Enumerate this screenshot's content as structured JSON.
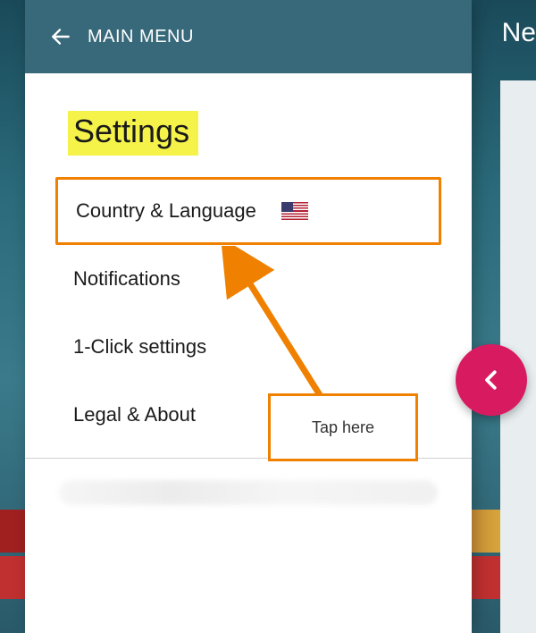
{
  "header": {
    "title": "MAIN MENU",
    "back_icon": "arrow-left"
  },
  "partial_text_right": "Ne",
  "section": {
    "title": "Settings"
  },
  "menu": {
    "items": [
      {
        "label": "Country & Language",
        "highlighted": true,
        "showsFlag": true,
        "flag": "us"
      },
      {
        "label": "Notifications"
      },
      {
        "label": "1-Click settings"
      },
      {
        "label": "Legal & About"
      }
    ]
  },
  "callout": {
    "text": "Tap here"
  },
  "fab": {
    "icon": "chevron-left"
  },
  "colors": {
    "highlight_border": "#f08000",
    "title_highlight_bg": "#f5f34a",
    "header_bg": "#37697a",
    "fab_bg": "#d81b60"
  }
}
